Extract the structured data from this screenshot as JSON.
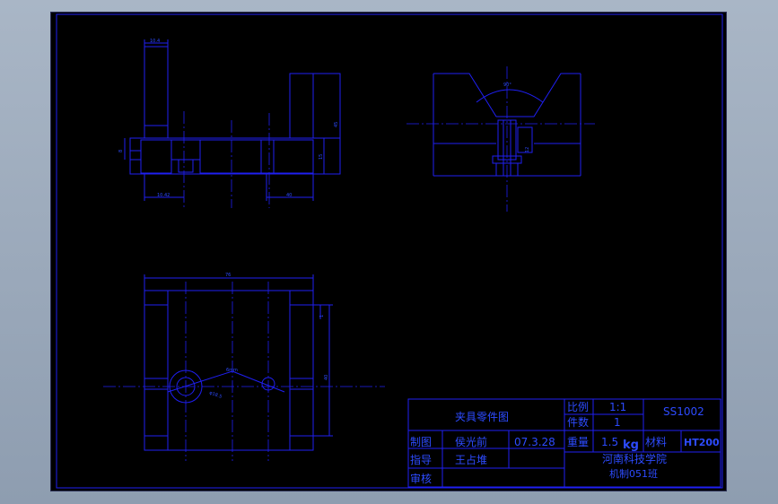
{
  "title_block": {
    "drawing_title": "夹具零件图",
    "scale_label": "比例",
    "scale_value": "1:1",
    "quantity_label": "件数",
    "quantity_value": "1",
    "weight_label": "重量",
    "weight_value": "1.5",
    "weight_unit": "kg",
    "material_label": "材料",
    "material_value": "HT200",
    "drawing_number": "SS1002",
    "drawn_label": "制图",
    "drawn_name": "侯光前",
    "drawn_date": "07.3.28",
    "guide_label": "指导",
    "guide_name": "王占堆",
    "review_label": "审核",
    "school": "河南科技学院",
    "class_name": "机制051班"
  },
  "dimensions": {
    "front_top_width": "10.4",
    "front_left_height": "8",
    "front_bottom_left": "10.42",
    "front_bottom_right": "40",
    "front_right_height": "15",
    "front_total_height": "45",
    "side_angle": "90°",
    "side_hole": "12",
    "top_total_width": "76",
    "top_right_small": "1",
    "top_right_height": "40",
    "top_center_mark": "6mm",
    "top_hole_dia": "φ18.5"
  },
  "colors": {
    "background": "#000000",
    "line": "#1f1ff2",
    "text": "#2d4bff"
  }
}
